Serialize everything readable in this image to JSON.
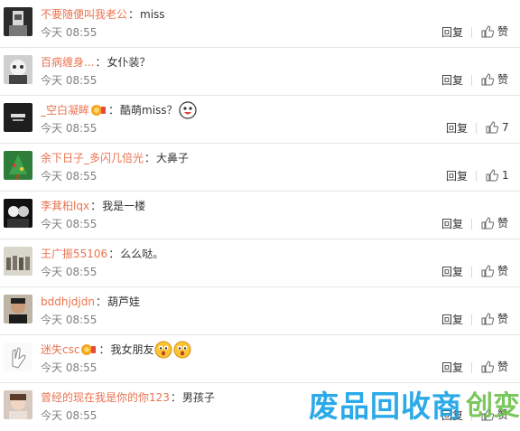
{
  "comments": [
    {
      "user": "不要随便叫我老公",
      "sep": "：",
      "text": "miss",
      "time": "今天 08:55",
      "reply": "回复",
      "like": "赞",
      "badge": false,
      "emojis": 0
    },
    {
      "user": "百病缠身...",
      "sep": "：",
      "text": "女仆装？",
      "time": "今天 08:55",
      "reply": "回复",
      "like": "赞",
      "badge": false,
      "emojis": 0
    },
    {
      "user": "_空白凝眸",
      "sep": "：",
      "text": "酷萌miss？",
      "time": "今天 08:55",
      "reply": "回复",
      "like": "7",
      "badge": true,
      "emojis": 1
    },
    {
      "user": "余下日子_多闪几倍光",
      "sep": "：",
      "text": "大鼻子",
      "time": "今天 08:55",
      "reply": "回复",
      "like": "1",
      "badge": false,
      "emojis": 0
    },
    {
      "user": "李萁桕lqx",
      "sep": "：",
      "text": "我是一楼",
      "time": "今天 08:55",
      "reply": "回复",
      "like": "赞",
      "badge": false,
      "emojis": 0
    },
    {
      "user": "王广振55106",
      "sep": "：",
      "text": "么么哒。",
      "time": "今天 08:55",
      "reply": "回复",
      "like": "赞",
      "badge": false,
      "emojis": 0
    },
    {
      "user": "bddhjdjdn",
      "sep": "：",
      "text": "葫芦娃",
      "time": "今天 08:55",
      "reply": "回复",
      "like": "赞",
      "badge": false,
      "emojis": 0
    },
    {
      "user": "迷失csc",
      "sep": "：",
      "text": "我女朋友",
      "time": "今天 08:55",
      "reply": "回复",
      "like": "赞",
      "badge": true,
      "emojis": 2
    },
    {
      "user": "曾经的现在我是你的你123",
      "sep": "：",
      "text": "男孩子",
      "time": "今天 08:55",
      "reply": "回复",
      "like": "赞",
      "badge": false,
      "emojis": 0
    }
  ],
  "watermark": {
    "text": "废品回收商",
    "suffix": "创变"
  },
  "colors": {
    "username": "#eb7350",
    "time": "#808080",
    "border": "#e6e6e6",
    "watermark": "#1aa3e8"
  }
}
